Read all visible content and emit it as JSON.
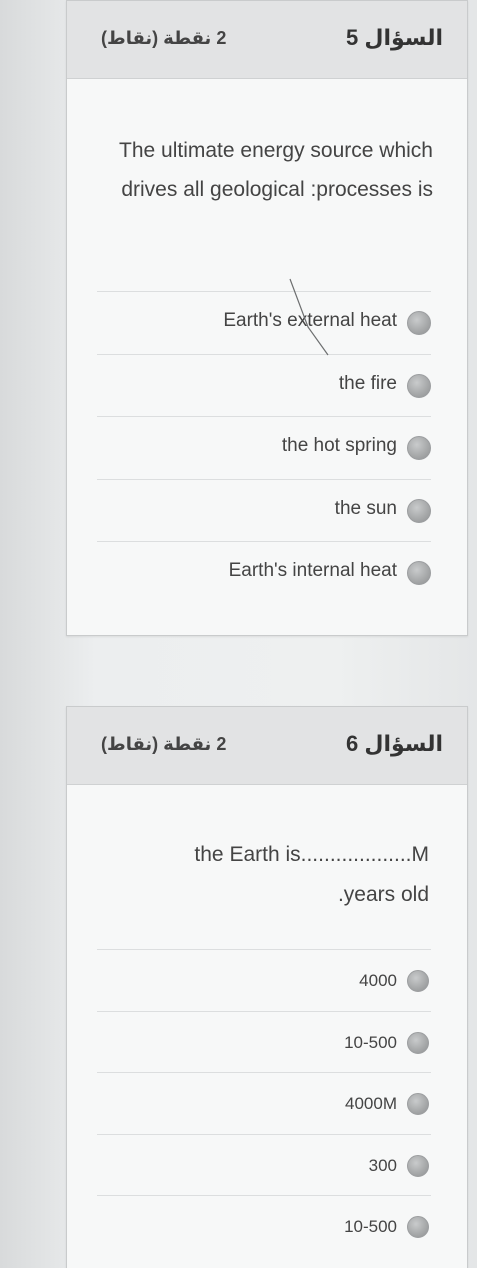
{
  "questions": [
    {
      "number_label": "السؤال 5",
      "points_label": "2 نقطة (نقاط)",
      "text": "The ultimate energy source which drives all geological :processes is",
      "answers": [
        {
          "label": "Earth's external heat"
        },
        {
          "label": "the fire"
        },
        {
          "label": "the hot spring"
        },
        {
          "label": "the sun"
        },
        {
          "label": "Earth's internal heat"
        }
      ]
    },
    {
      "number_label": "السؤال 6",
      "points_label": "2 نقطة (نقاط)",
      "text": "the Earth is...................M .years old",
      "answers": [
        {
          "label": "4000"
        },
        {
          "label": "10-500"
        },
        {
          "label": "4000M"
        },
        {
          "label": "300"
        },
        {
          "label": "10-500"
        }
      ]
    }
  ],
  "colors": {
    "header_bg": "#e2e3e4",
    "card_bg": "#f7f8f8",
    "radio": "#a8aaab",
    "text": "#444444"
  }
}
